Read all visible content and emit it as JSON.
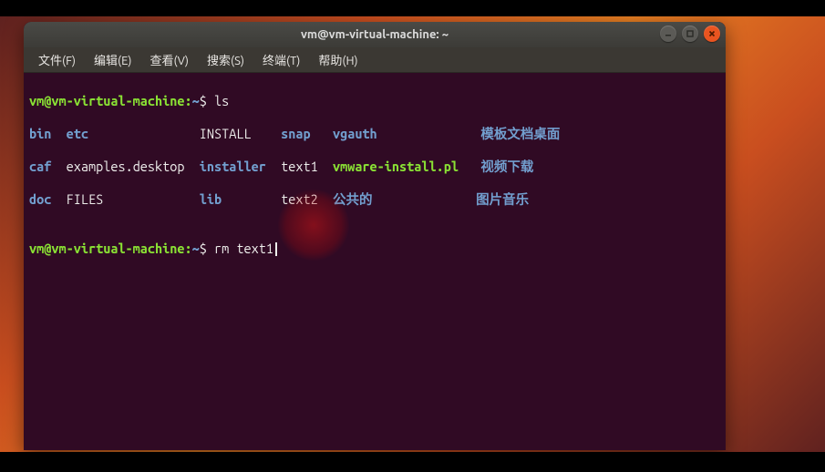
{
  "window": {
    "title": "vm@vm-virtual-machine: ~"
  },
  "menubar": {
    "items": [
      "文件(F)",
      "编辑(E)",
      "查看(V)",
      "搜索(S)",
      "终端(T)",
      "帮助(H)"
    ]
  },
  "prompt": {
    "userhost": "vm@vm-virtual-machine",
    "path": "~",
    "sep": ":",
    "symbol": "$"
  },
  "commands": {
    "first": "ls",
    "second": "rm text1"
  },
  "ls_output": {
    "rows": [
      [
        {
          "text": "bin",
          "cls": "dir-c",
          "w": 5
        },
        {
          "text": "etc",
          "cls": "dir-c",
          "w": 18
        },
        {
          "text": "INSTALL",
          "cls": "file-c",
          "w": 11
        },
        {
          "text": "snap",
          "cls": "dir-c",
          "w": 7
        },
        {
          "text": "vgauth",
          "cls": "dir-c",
          "w": 20
        },
        {
          "text": "模板",
          "cls": "dir-c",
          "w": 4
        },
        {
          "text": "文档",
          "cls": "dir-c",
          "w": 4
        },
        {
          "text": "桌面",
          "cls": "dir-c",
          "w": 0
        }
      ],
      [
        {
          "text": "caf",
          "cls": "dir-c",
          "w": 5
        },
        {
          "text": "examples.desktop",
          "cls": "file-c",
          "w": 18
        },
        {
          "text": "installer",
          "cls": "dir-c",
          "w": 11
        },
        {
          "text": "text1",
          "cls": "file-c",
          "w": 7
        },
        {
          "text": "vmware-install.pl",
          "cls": "exec-c",
          "w": 20
        },
        {
          "text": "视频",
          "cls": "dir-c",
          "w": 4
        },
        {
          "text": "下载",
          "cls": "dir-c",
          "w": 0
        }
      ],
      [
        {
          "text": "doc",
          "cls": "dir-c",
          "w": 5
        },
        {
          "text": "FILES",
          "cls": "file-c",
          "w": 18
        },
        {
          "text": "lib",
          "cls": "dir-c",
          "w": 11
        },
        {
          "text": "text2",
          "cls": "file-c",
          "w": 7
        },
        {
          "text": "公共的",
          "cls": "dir-c",
          "w": 20
        },
        {
          "text": "图片",
          "cls": "dir-c",
          "w": 4
        },
        {
          "text": "音乐",
          "cls": "dir-c",
          "w": 0
        }
      ]
    ]
  }
}
